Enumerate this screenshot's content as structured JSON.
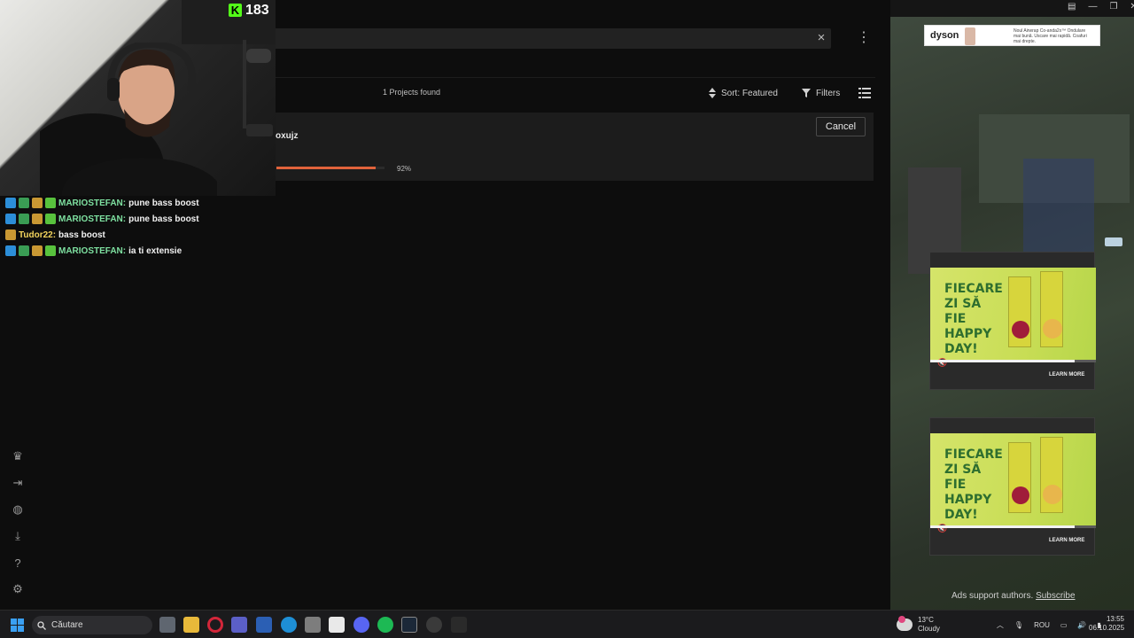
{
  "stream": {
    "viewer_count": "183",
    "kick_logo": "K"
  },
  "app": {
    "search_clear_icon": "×",
    "menu_icon": "⋮",
    "projects_found": "1 Projects found",
    "sort_label": "Sort: Featured",
    "filters_label": "Filters",
    "project": {
      "name_fragment": "oxujz",
      "progress_percent": 92,
      "progress_text": "92%"
    },
    "cancel_label": "Cancel"
  },
  "chat": {
    "messages": [
      {
        "user": "MARIOSTEFAN:",
        "text": "pune bass boost"
      },
      {
        "user": "MARIOSTEFAN:",
        "text": "pune bass boost"
      },
      {
        "user": "Tudor22:",
        "text": "bass boost"
      },
      {
        "user": "MARIOSTEFAN:",
        "text": "ia ti extensie"
      }
    ]
  },
  "sidebar": {
    "icons": [
      "crown-icon",
      "login-icon",
      "globe-icon",
      "download-icon",
      "help-icon",
      "settings-icon"
    ]
  },
  "ads": {
    "dyson_logo": "dyson",
    "dyson_copy": "Noul Airwrap Co-anda2x™ Ondulare mai bună. Uscare mai rapidă. Coafuri mai drepte.",
    "video_ad_headline": "FIECARE ZI SĂ FIE HAPPY DAY!",
    "video_ad_1_progress": 0.87,
    "video_ad_2_progress": 0.87,
    "learn_more": "LEARN MORE",
    "support_text": "Ads support authors.",
    "subscribe": "Subscribe"
  },
  "taskbar": {
    "search_placeholder": "Căutare",
    "weather_temp": "13°C",
    "weather_desc": "Cloudy",
    "language": "ROU",
    "time": "13:55",
    "date": "06.10.2025"
  },
  "colors": {
    "accent_progress": "#e0623b",
    "chat_username": "#7ee0a0",
    "kick_green": "#53fc18"
  }
}
